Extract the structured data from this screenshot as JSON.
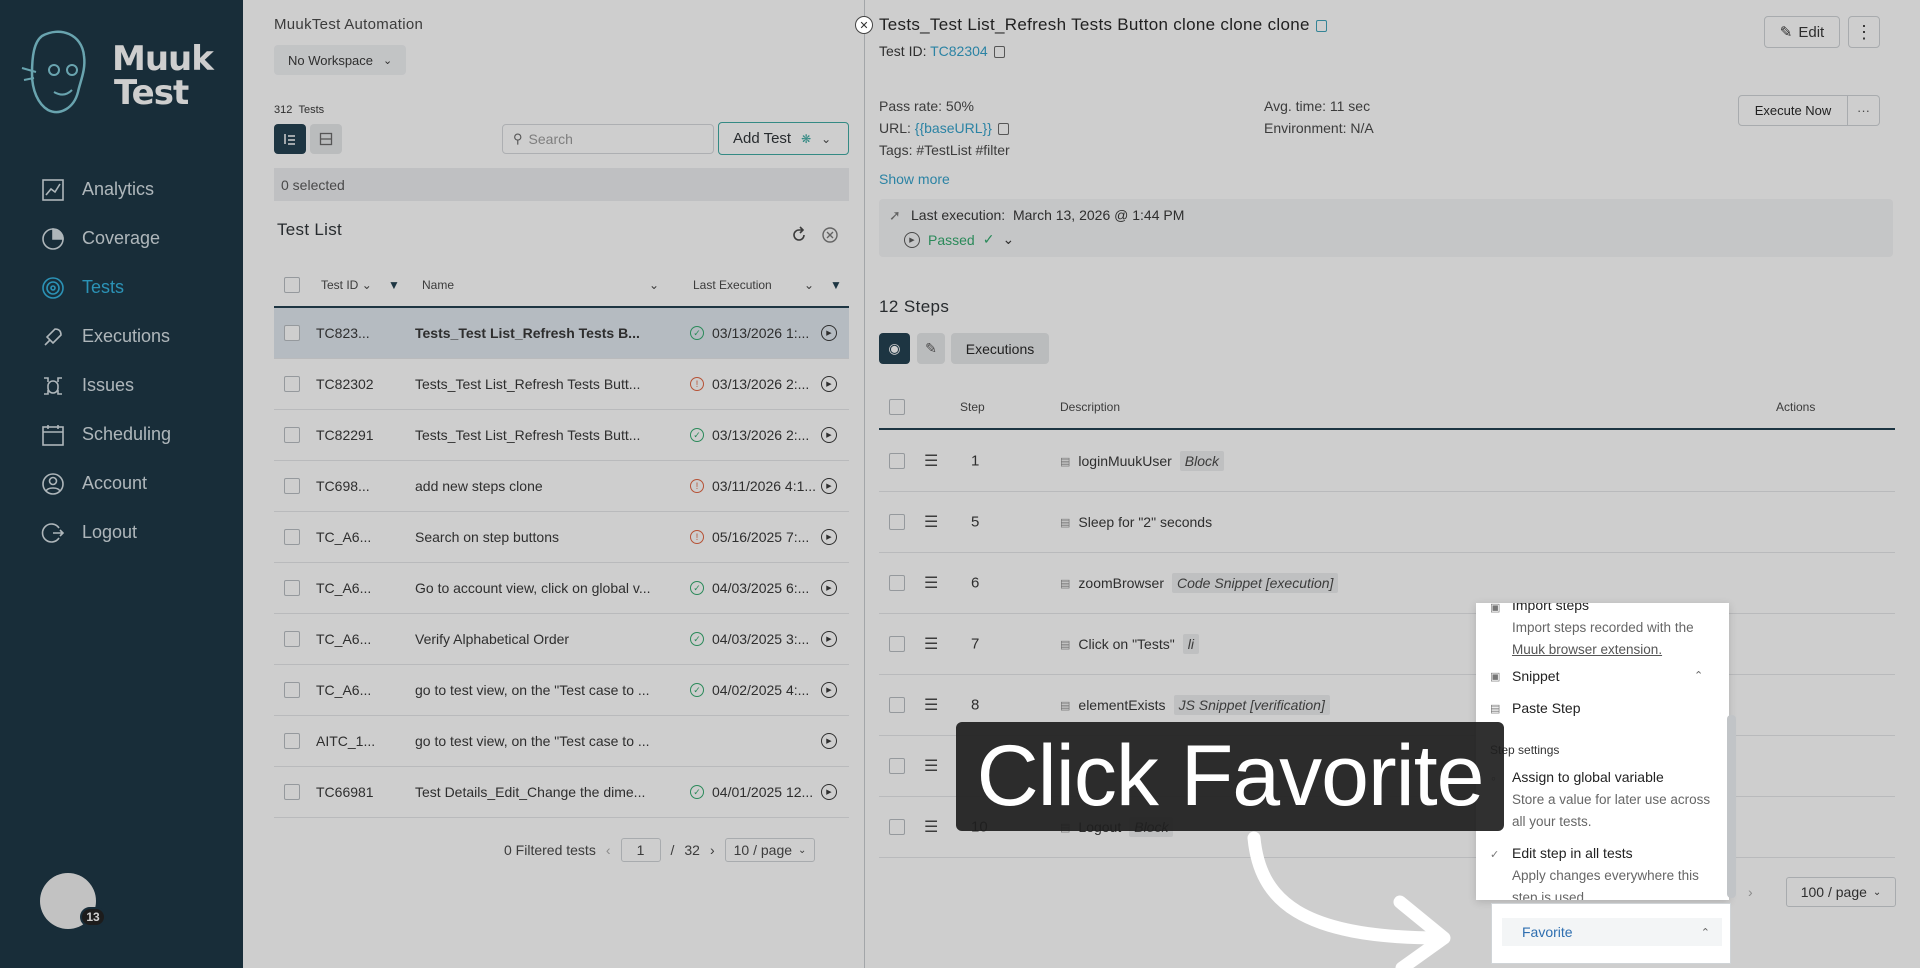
{
  "sidebar": {
    "logo_line1": "Muuk",
    "logo_line2": "Test",
    "items": [
      {
        "label": "Analytics",
        "icon": "analytics-icon"
      },
      {
        "label": "Coverage",
        "icon": "coverage-icon"
      },
      {
        "label": "Tests",
        "icon": "tests-icon",
        "active": true
      },
      {
        "label": "Executions",
        "icon": "rocket-icon"
      },
      {
        "label": "Issues",
        "icon": "bug-icon"
      },
      {
        "label": "Scheduling",
        "icon": "calendar-icon"
      },
      {
        "label": "Account",
        "icon": "user-icon"
      },
      {
        "label": "Logout",
        "icon": "logout-icon"
      }
    ],
    "avatar_badge": "13"
  },
  "list": {
    "app_title": "MuukTest Automation",
    "workspace": "No Workspace",
    "tests_count": "312",
    "tests_label": "Tests",
    "search_placeholder": "Search",
    "add_test": "Add Test",
    "selected": "0 selected",
    "title": "Test List",
    "columns": {
      "id": "Test ID",
      "name": "Name",
      "last_exec": "Last Execution"
    },
    "rows": [
      {
        "id": "TC823...",
        "name": "Tests_Test List_Refresh Tests B...",
        "status": "pass",
        "date": "03/13/2026 1:..."
      },
      {
        "id": "TC82302",
        "name": "Tests_Test List_Refresh Tests Butt...",
        "status": "fail",
        "date": "03/13/2026 2:..."
      },
      {
        "id": "TC82291",
        "name": "Tests_Test List_Refresh Tests Butt...",
        "status": "pass",
        "date": "03/13/2026 2:..."
      },
      {
        "id": "TC698...",
        "name": "add new steps clone",
        "status": "fail",
        "date": "03/11/2026 4:1..."
      },
      {
        "id": "TC_A6...",
        "name": "Search on step buttons",
        "status": "fail",
        "date": "05/16/2025 7:..."
      },
      {
        "id": "TC_A6...",
        "name": "Go to account view, click on global v...",
        "status": "pass",
        "date": "04/03/2025 6:..."
      },
      {
        "id": "TC_A6...",
        "name": "Verify Alphabetical Order",
        "status": "pass",
        "date": "04/03/2025 3:..."
      },
      {
        "id": "TC_A6...",
        "name": "go to test view, on the \"Test case to ...",
        "status": "pass",
        "date": "04/02/2025 4:..."
      },
      {
        "id": "AITC_1...",
        "name": "go to test view, on the \"Test case to ...",
        "status": "none",
        "date": ""
      },
      {
        "id": "TC66981",
        "name": "Test Details_Edit_Change the dime...",
        "status": "pass",
        "date": "04/01/2025 12..."
      }
    ],
    "pager": {
      "filtered": "0 Filtered tests",
      "page": "1",
      "of": "/",
      "total": "32",
      "size": "10 / page"
    }
  },
  "detail": {
    "title": "Tests_Test List_Refresh Tests Button clone clone clone",
    "test_id_label": "Test ID:",
    "test_id": "TC82304",
    "edit": "Edit",
    "pass_rate": "Pass rate: 50%",
    "url_label": "URL:",
    "url": "{{baseURL}}",
    "tags": "Tags: #TestList #filter",
    "avg_time": "Avg. time: 11 sec",
    "environment": "Environment: N/A",
    "execute_now": "Execute Now",
    "show_more": "Show more",
    "last_exec_label": "Last execution:",
    "last_exec_date": "March 13, 2026 @ 1:44 PM",
    "last_exec_status": "Passed",
    "steps_title": "12 Steps",
    "executions_tab": "Executions",
    "step_columns": {
      "step": "Step",
      "description": "Description",
      "actions": "Actions"
    },
    "steps": [
      {
        "num": "1",
        "text": "loginMuukUser",
        "tag": "Block"
      },
      {
        "num": "5",
        "text": "Sleep for  \"2\"      seconds",
        "tag": ""
      },
      {
        "num": "6",
        "text": "zoomBrowser",
        "tag": "Code Snippet [execution]"
      },
      {
        "num": "7",
        "text": "Click on  \"Tests\"",
        "tag": "li"
      },
      {
        "num": "8",
        "text": "elementExists",
        "tag": "JS Snippet [verification]"
      },
      {
        "num": "",
        "text": "",
        "tag": ""
      },
      {
        "num": "10",
        "text": "Logout",
        "tag": "Block"
      }
    ],
    "page_size": "100 / page"
  },
  "menu": {
    "import_title": "Import steps",
    "import_desc_1": "Import steps recorded with the",
    "import_desc_link": "Muuk browser extension.",
    "snippet": "Snippet",
    "paste_step": "Paste Step",
    "section": "Step settings",
    "assign_title": "Assign to global variable",
    "assign_desc": "Store a value for later use across all your tests.",
    "edit_all_title": "Edit step in all tests",
    "edit_all_desc": "Apply changes everywhere this step is used.",
    "favorite": "Favorite"
  },
  "callout": {
    "text": "Click Favorite"
  }
}
